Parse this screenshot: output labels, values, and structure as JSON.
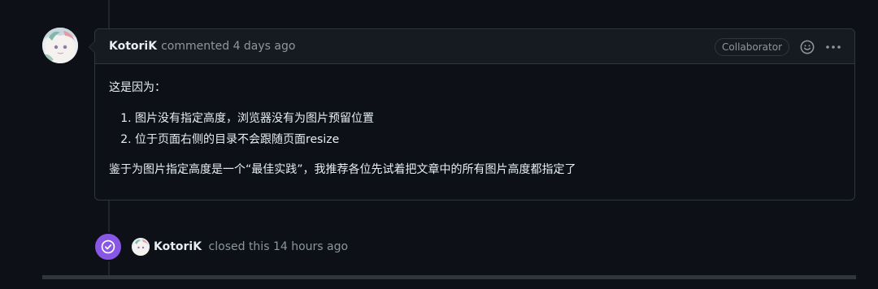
{
  "comment": {
    "author": "KotoriK",
    "action": "commented",
    "time": "4 days ago",
    "role_badge": "Collaborator",
    "body": {
      "intro": "这是因为：",
      "list_items": [
        "图片没有指定高度，浏览器没有为图片预留位置",
        "位于页面右侧的目录不会跟随页面resize"
      ],
      "conclusion": "鉴于为图片指定高度是一个“最佳实践”，我推荐各位先试着把文章中的所有图片高度都指定了"
    }
  },
  "event": {
    "author": "KotoriK",
    "action": "closed this",
    "time": "14 hours ago"
  },
  "icons": {
    "reaction": "smiley-icon",
    "more": "kebab-horizontal-icon",
    "closed": "issue-closed-icon"
  },
  "colors": {
    "background": "#0d1117",
    "header_background": "#161b22",
    "border": "#30363d",
    "closed_purple": "#8957e5",
    "muted_text": "#8d96a0"
  }
}
